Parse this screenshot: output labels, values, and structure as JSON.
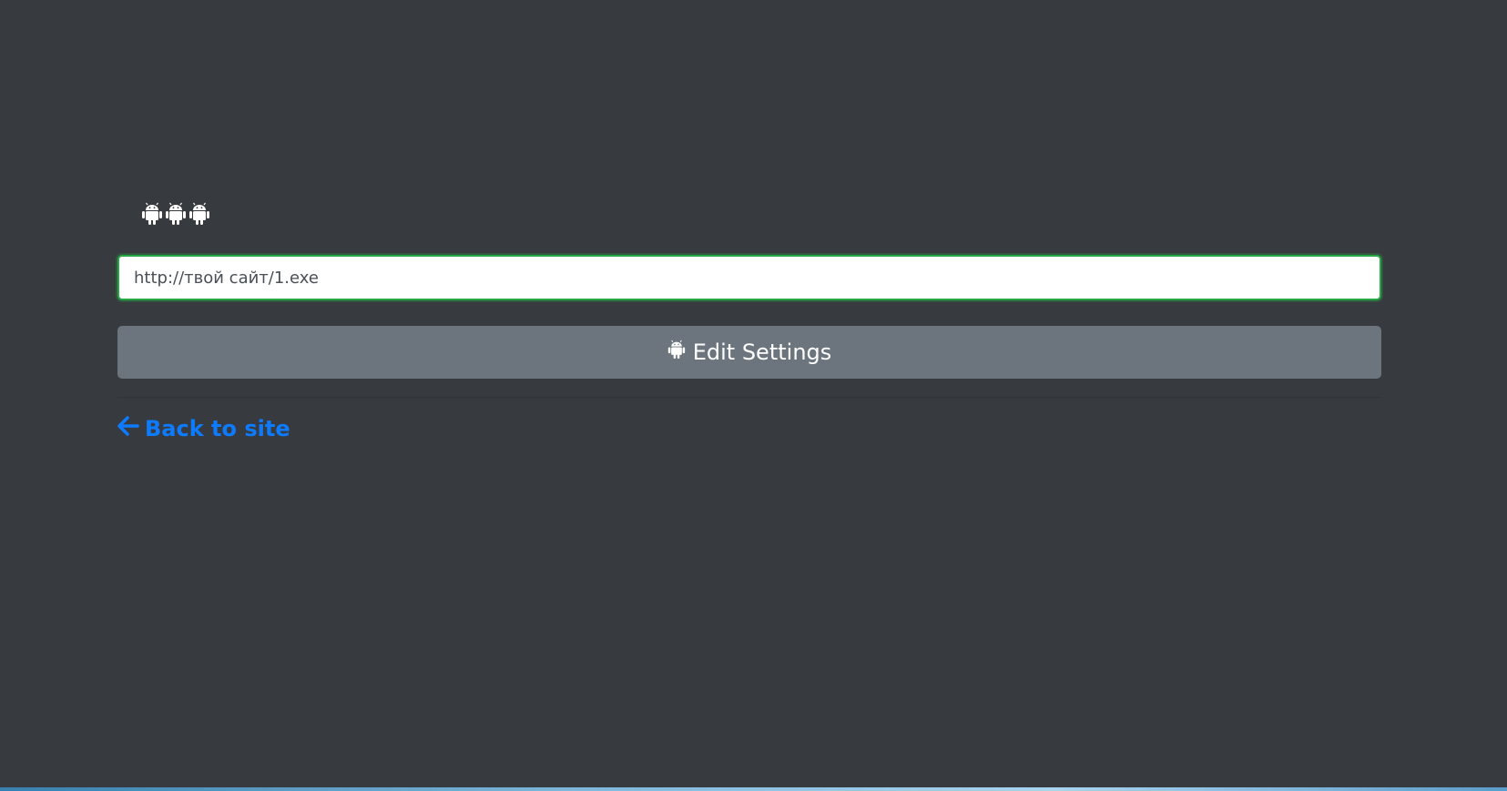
{
  "header": {
    "icons": [
      "android-icon",
      "android-icon",
      "android-icon"
    ]
  },
  "form": {
    "url_value": "http://твой сайт/1.exe",
    "submit_label": "Edit Settings",
    "submit_icon": "android-icon"
  },
  "footer": {
    "back_label": "Back to site",
    "back_icon": "arrow-left-icon"
  },
  "colors": {
    "background": "#373b3f",
    "input_border": "#28a745",
    "button": "#6c757d",
    "link": "#0d7bff"
  }
}
